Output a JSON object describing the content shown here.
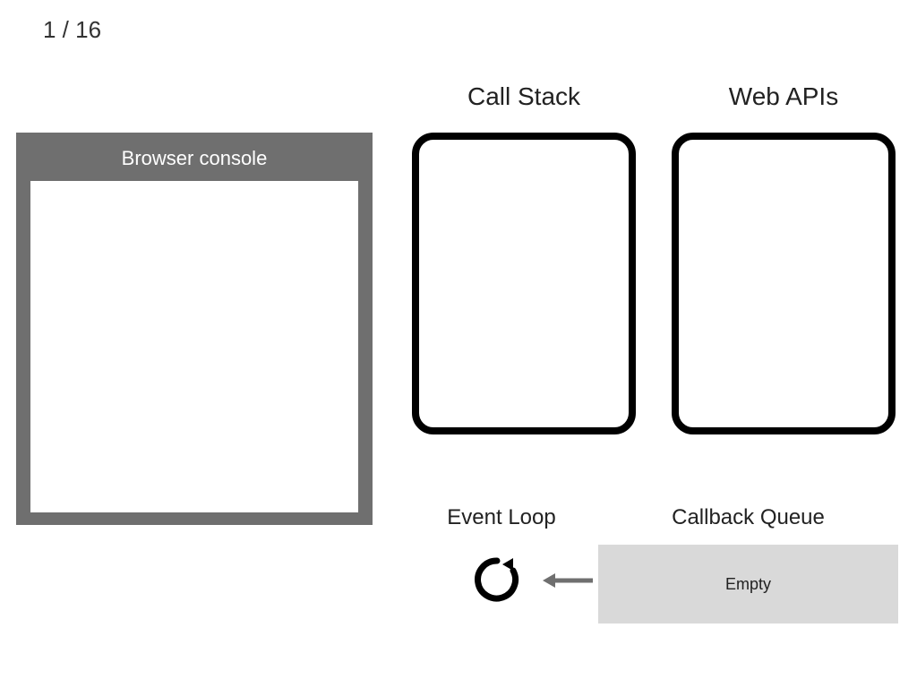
{
  "pager": {
    "current": 1,
    "total": 16,
    "display": "1 / 16"
  },
  "console": {
    "title": "Browser console"
  },
  "labels": {
    "call_stack": "Call Stack",
    "web_apis": "Web APIs",
    "event_loop": "Event Loop",
    "callback_queue": "Callback Queue"
  },
  "callback_queue": {
    "status": "Empty"
  },
  "icons": {
    "loop": "loop-icon",
    "arrow_left": "arrow-left-icon"
  },
  "colors": {
    "console_bg": "#6f6f6f",
    "console_text": "#ffffff",
    "queue_bg": "#d9d9d9",
    "box_border": "#000000"
  }
}
